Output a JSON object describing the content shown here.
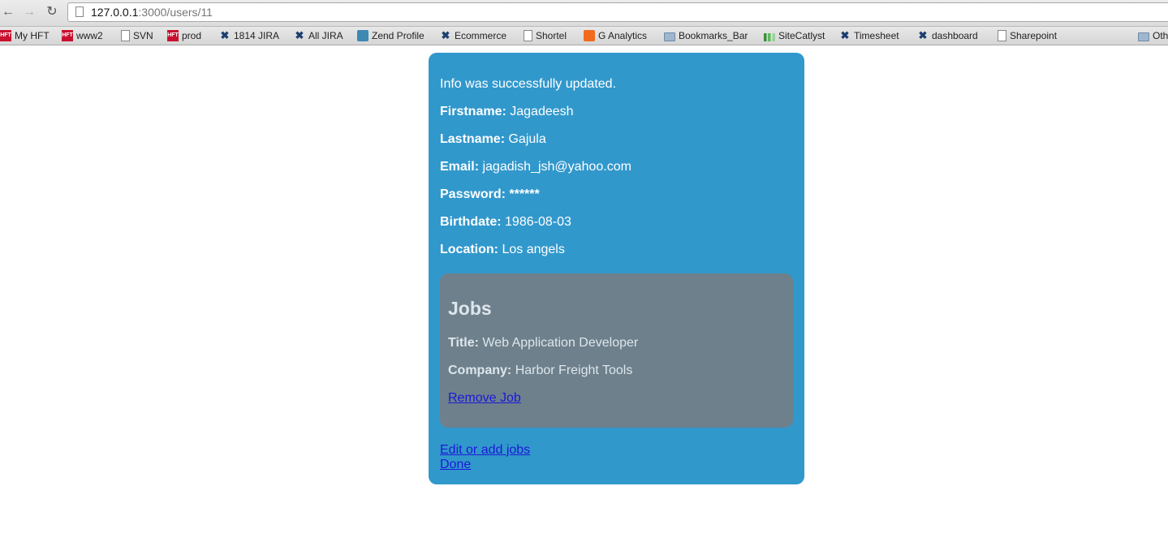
{
  "browser": {
    "url_host": "127.0.0.1",
    "url_path": ":3000/users/11"
  },
  "bookmarks": [
    {
      "label": "My HFT",
      "icon": "hft-icon"
    },
    {
      "label": "www2",
      "icon": "hft-icon"
    },
    {
      "label": "SVN",
      "icon": "page-icon"
    },
    {
      "label": "prod",
      "icon": "hft-icon"
    },
    {
      "label": "1814 JIRA",
      "icon": "jira-icon"
    },
    {
      "label": "All JIRA",
      "icon": "jira-icon"
    },
    {
      "label": "Zend Profile",
      "icon": "zend-icon"
    },
    {
      "label": "Ecommerce",
      "icon": "jira-icon"
    },
    {
      "label": "Shortel",
      "icon": "page-icon"
    },
    {
      "label": "G Analytics",
      "icon": "analytics-icon"
    },
    {
      "label": "Bookmarks_Bar",
      "icon": "folder-icon"
    },
    {
      "label": "SiteCatlyst",
      "icon": "sitecatalyst-icon"
    },
    {
      "label": "Timesheet",
      "icon": "jira-icon"
    },
    {
      "label": "dashboard",
      "icon": "jira-icon"
    },
    {
      "label": "Sharepoint",
      "icon": "page-icon"
    },
    {
      "label": "Oth",
      "icon": "folder-icon"
    }
  ],
  "user": {
    "notice": "Info was successfully updated.",
    "firstname_label": "Firstname:",
    "firstname": "Jagadeesh",
    "lastname_label": "Lastname:",
    "lastname": "Gajula",
    "email_label": "Email:",
    "email": "jagadish_jsh@yahoo.com",
    "password_label": "Password:",
    "password": "******",
    "birthdate_label": "Birthdate:",
    "birthdate": "1986-08-03",
    "location_label": "Location:",
    "location": "Los angels"
  },
  "jobs": {
    "heading": "Jobs",
    "title_label": "Title:",
    "title": "Web Application Developer",
    "company_label": "Company:",
    "company": "Harbor Freight Tools",
    "remove_link": "Remove Job"
  },
  "actions": {
    "edit_jobs": "Edit or add jobs",
    "done": "Done"
  }
}
